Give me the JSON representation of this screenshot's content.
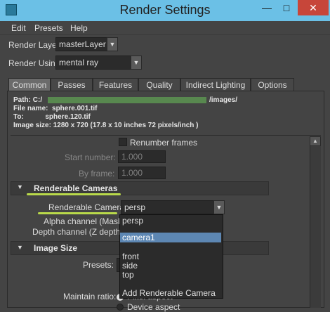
{
  "window": {
    "title": "Render Settings",
    "close": "✕",
    "minimize": "—",
    "maximize": "□"
  },
  "menubar": [
    "Edit",
    "Presets",
    "Help"
  ],
  "render_layer": {
    "label": "Render Layer",
    "value": "masterLayer"
  },
  "render_using": {
    "label": "Render Using",
    "value": "mental ray"
  },
  "tabs": [
    "Common",
    "Passes",
    "Features",
    "Quality",
    "Indirect Lighting",
    "Options"
  ],
  "active_tab": "Common",
  "info": {
    "path_prefix": "Path: C:/",
    "path_suffix": "/images/",
    "file_name": "File name:  sphere.001.tif",
    "to": "To:           sphere.120.tif",
    "image_size": "Image size: 1280 x 720 (17.8 x 10 inches 72 pixels/inch )"
  },
  "frame_range": {
    "renumber_label": "Renumber frames",
    "start_label": "Start number:",
    "start_value": "1.000",
    "by_label": "By frame:",
    "by_value": "1.000"
  },
  "renderable_cameras": {
    "title": "Renderable Cameras",
    "camera_label": "Renderable Camera",
    "camera_value": "persp",
    "alpha_label": "Alpha channel (Mask)",
    "depth_label": "Depth channel (Z depth)"
  },
  "camera_menu": {
    "items": [
      "persp",
      "camera1",
      "front",
      "side",
      "top",
      "Add Renderable Camera"
    ],
    "selected": "camera1"
  },
  "image_size": {
    "title": "Image Size",
    "presets_label": "Presets:",
    "maintain_label": "Maintain ratio:",
    "maintain_option_1": "Pixel aspect",
    "maintain_option_2": "Device aspect"
  },
  "colors": {
    "title_bar": "#6bc0e6",
    "highlight": "#b9d94a",
    "selection": "#5d87b3",
    "close": "#c7463a"
  }
}
